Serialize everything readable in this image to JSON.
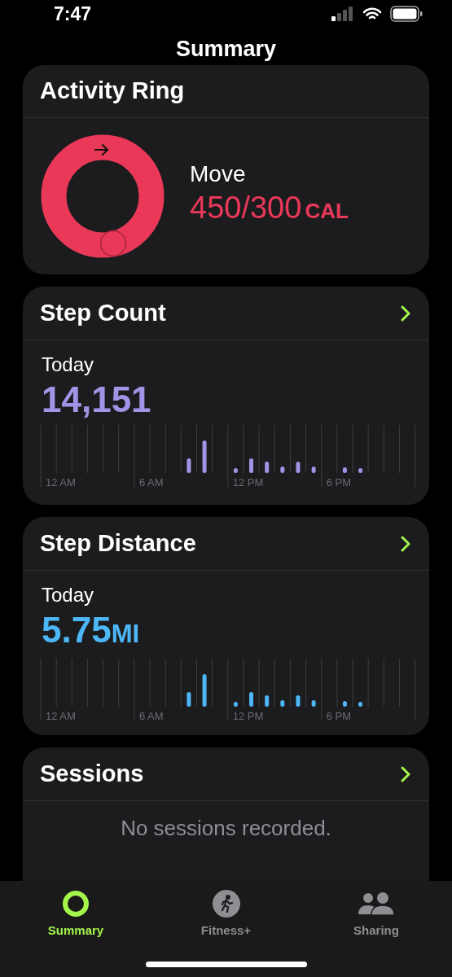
{
  "status_bar": {
    "time": "7:47"
  },
  "title": "Summary",
  "activity_ring": {
    "title": "Activity Ring",
    "label": "Move",
    "value": "450/300",
    "unit": "CAL"
  },
  "metric_cards": [
    {
      "title": "Step Count",
      "period": "Today",
      "value": "14,151",
      "color": "#a293e6",
      "axis_labels": [
        "12 AM",
        "6 AM",
        "12 PM",
        "6 PM"
      ]
    },
    {
      "title": "Step Distance",
      "period": "Today",
      "value": "5.75",
      "unit": "MI",
      "color": "#4db6f7",
      "axis_labels": [
        "12 AM",
        "6 AM",
        "12 PM",
        "6 PM"
      ]
    }
  ],
  "sessions": {
    "title": "Sessions",
    "message": "No sessions recorded."
  },
  "tabs": [
    {
      "label": "Summary",
      "kind": "ring",
      "selected": true
    },
    {
      "label": "Fitness+",
      "kind": "runner",
      "selected": false
    },
    {
      "label": "Sharing",
      "kind": "people",
      "selected": false
    }
  ]
}
